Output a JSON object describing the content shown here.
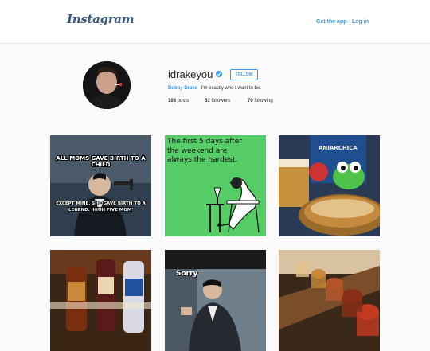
{
  "header": {
    "logo_text": "Instagram",
    "get_app_label": "Get the app",
    "login_label": "Log in"
  },
  "profile": {
    "username": "idrakeyou",
    "verified_icon": "verified-badge-icon",
    "follow_label": "FOLLOW",
    "full_name": "Bobby Drake",
    "bio": "I'm exactly who I want to be.",
    "posts_count": "108",
    "posts_label": "posts",
    "followers_count": "51",
    "followers_label": "followers",
    "following_count": "70",
    "following_label": "following"
  },
  "posts": {
    "meme_top": "ALL MOMS GAVE BIRTH TO A CHILD",
    "meme_bottom": "EXCEPT MINE, SHE GAVE BIRTH TO A LEGEND. 'HIGH FIVE MOM'",
    "ecard_text": "The first 5 days after the weekend are always the hardest.",
    "sorry_text": "Sorry"
  },
  "colors": {
    "accent": "#3897f0",
    "logo": "#3b5a86",
    "ecard_green": "#55cc66"
  }
}
